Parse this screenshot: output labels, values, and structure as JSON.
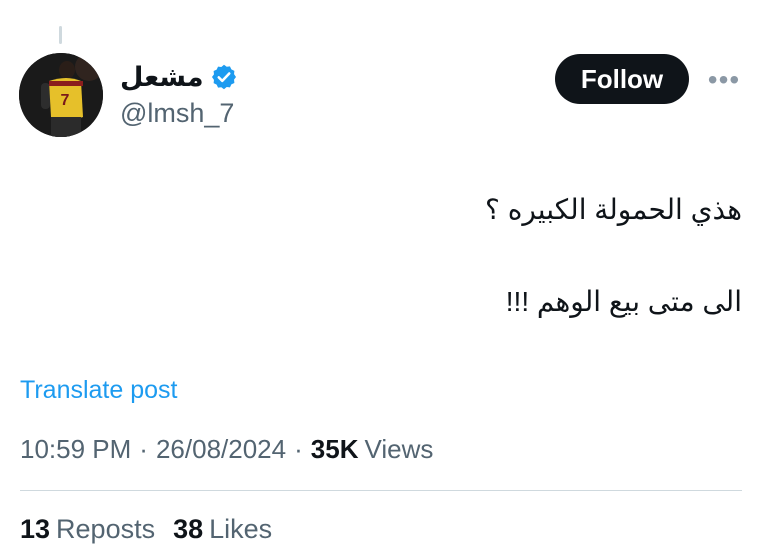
{
  "author": {
    "display_name": "مشعل",
    "handle": "@lmsh_7",
    "verified": true,
    "avatar_jersey_number": "7"
  },
  "actions": {
    "follow_label": "Follow",
    "more_label": "•••"
  },
  "post": {
    "lines": [
      "هذي الحمولة الكبيره ؟",
      "الى متى بيع الوهم !!!"
    ],
    "translate_label": "Translate post"
  },
  "meta": {
    "time": "10:59 PM",
    "separator": "·",
    "date": "26/08/2024",
    "views_count": "35K",
    "views_label": "Views"
  },
  "stats": {
    "reposts_count": "13",
    "reposts_label": "Reposts",
    "likes_count": "38",
    "likes_label": "Likes"
  },
  "colors": {
    "text": "#0f1419",
    "secondary": "#536471",
    "link": "#1d9bf0",
    "verified": "#1d9bf0",
    "follow_bg": "#0f1419"
  }
}
